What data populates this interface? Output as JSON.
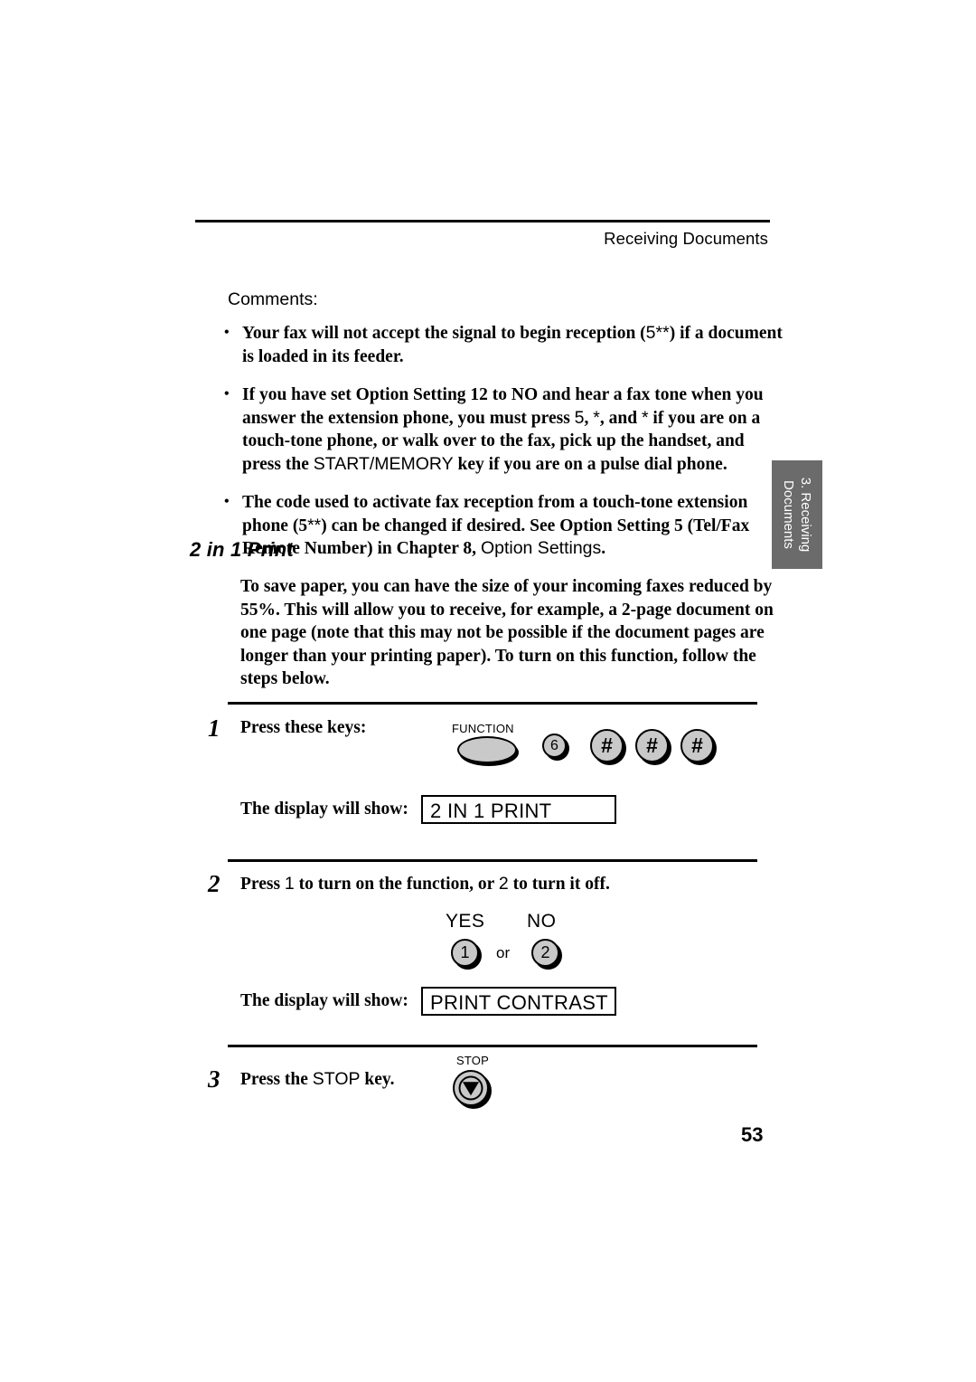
{
  "header": {
    "title": "Receiving Documents"
  },
  "side_tab": {
    "line1": "3. Receiving",
    "line2": "Documents",
    "background_color": "#6b6b6b",
    "text_color": "#ffffff"
  },
  "comments": {
    "label": "Comments:",
    "bullets": [
      {
        "id": "bullet-reception-signal",
        "parts": [
          {
            "text": "Your fax will not accept the signal to begin reception (",
            "style": "serif-bold"
          },
          {
            "text": "5",
            "style": "sans"
          },
          {
            "text": "*",
            "style": "sans"
          },
          {
            "text": "*",
            "style": "sans"
          },
          {
            "text": ") if a document is loaded in its feeder.",
            "style": "serif-bold"
          }
        ]
      },
      {
        "id": "bullet-option-setting-12",
        "parts": [
          {
            "text": "If you have set Option Setting 12 to NO and hear a fax tone when you answer the extension phone, you must press ",
            "style": "serif-bold"
          },
          {
            "text": "5",
            "style": "sans"
          },
          {
            "text": ", ",
            "style": "serif-bold"
          },
          {
            "text": "*",
            "style": "sans"
          },
          {
            "text": ", and ",
            "style": "serif-bold"
          },
          {
            "text": "*",
            "style": "sans"
          },
          {
            "text": " if you are on a touch-tone phone, or walk over to the fax, pick up the handset, and press the ",
            "style": "serif-bold"
          },
          {
            "text": "START/MEMORY",
            "style": "sans"
          },
          {
            "text": " key if you are on a pulse dial phone.",
            "style": "serif-bold"
          }
        ]
      },
      {
        "id": "bullet-remote-code",
        "parts": [
          {
            "text": "The code used to activate fax reception from a touch-tone extension phone (",
            "style": "serif-bold"
          },
          {
            "text": "5",
            "style": "serif-bold"
          },
          {
            "text": "**",
            "style": "sans"
          },
          {
            "text": ") can be changed if desired. See Option Setting 5 (Tel/Fax Remote Number) in Chapter 8, ",
            "style": "serif-bold"
          },
          {
            "text": "Option Settings",
            "style": "sans"
          },
          {
            "text": ".",
            "style": "serif-bold"
          }
        ]
      }
    ]
  },
  "section": {
    "heading": "2 in 1 Print",
    "intro": "To save paper, you can have the size of your incoming faxes reduced by 55%. This will allow you to receive, for example, a 2-page document on one page (note that this may not be possible if the document pages are longer than your printing paper). To turn on this function, follow the steps below."
  },
  "steps": [
    {
      "number": "1",
      "text": "Press these keys:",
      "function_key_caption": "FUNCTION",
      "keys": [
        "6",
        "#",
        "#",
        "#"
      ],
      "display_label": "The display will show:",
      "display_value": "2 IN 1 PRINT"
    },
    {
      "number": "2",
      "text_parts": [
        {
          "text": "Press ",
          "style": "serif-bold"
        },
        {
          "text": "1",
          "style": "sans"
        },
        {
          "text": " to turn on the function, or ",
          "style": "serif-bold"
        },
        {
          "text": "2",
          "style": "sans"
        },
        {
          "text": " to turn it off.",
          "style": "serif-bold"
        }
      ],
      "yes_label": "YES",
      "no_label": "NO",
      "yes_key": "1",
      "no_key": "2",
      "or_text": "or",
      "display_label": "The display will show:",
      "display_value": "PRINT CONTRAST"
    },
    {
      "number": "3",
      "text_parts": [
        {
          "text": "Press the ",
          "style": "serif-bold"
        },
        {
          "text": "STOP",
          "style": "sans"
        },
        {
          "text": " key.",
          "style": "serif-bold"
        }
      ],
      "stop_key_caption": "STOP"
    }
  ],
  "page_number": "53"
}
